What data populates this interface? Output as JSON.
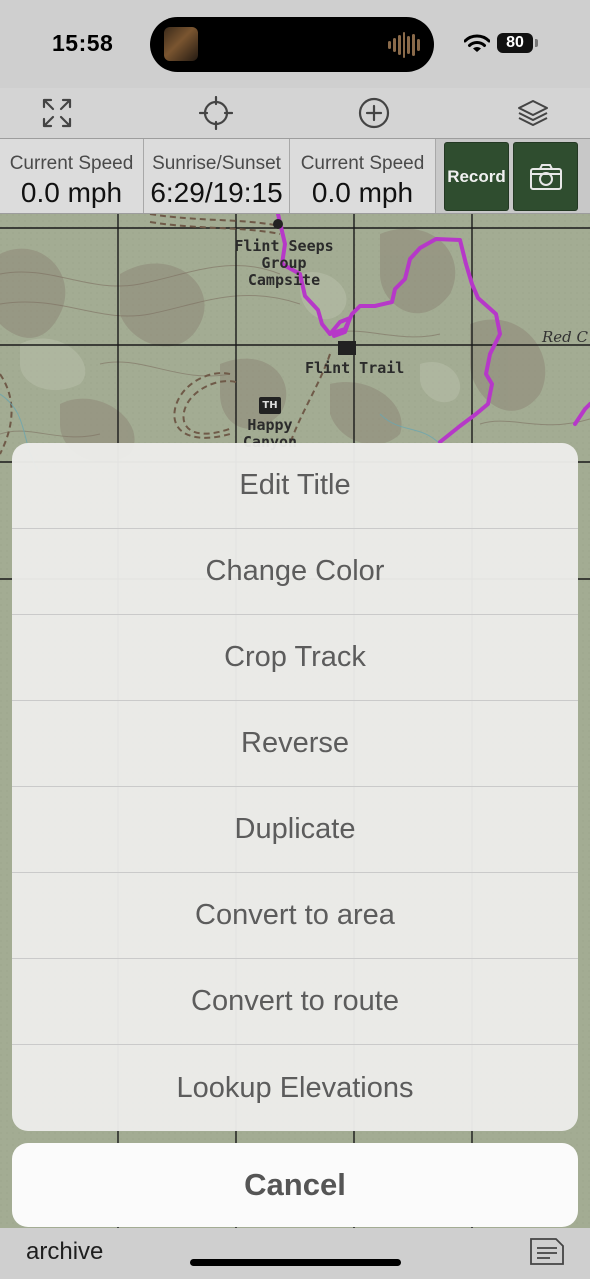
{
  "status_bar": {
    "time": "15:58",
    "battery": "80"
  },
  "toolbar": {
    "icons": [
      "expand-icon",
      "locate-crosshair-icon",
      "add-circle-icon",
      "layers-icon"
    ]
  },
  "info_bar": {
    "cells": [
      {
        "label": "Current Speed",
        "value": "0.0 mph"
      },
      {
        "label": "Sunrise/Sunset",
        "value": "6:29/19:15"
      },
      {
        "label": "Current Speed",
        "value": "0.0 mph"
      }
    ],
    "record_label": "Record",
    "camera_icon": "camera-icon"
  },
  "map": {
    "labels": {
      "flint_seeps": "Flint Seeps\nGroup\nCampsite",
      "flint_trail": "Flint Trail",
      "happy_canyon": "Happy\nCanyon",
      "red": "Red C",
      "th1": "TH",
      "th2": "TH"
    },
    "track_color": "#b638c8"
  },
  "action_sheet": {
    "items": [
      "Edit Title",
      "Change Color",
      "Crop Track",
      "Reverse",
      "Duplicate",
      "Convert to area",
      "Convert to route",
      "Lookup Elevations"
    ],
    "cancel_label": "Cancel"
  },
  "bottom": {
    "archive_label": "archive"
  }
}
